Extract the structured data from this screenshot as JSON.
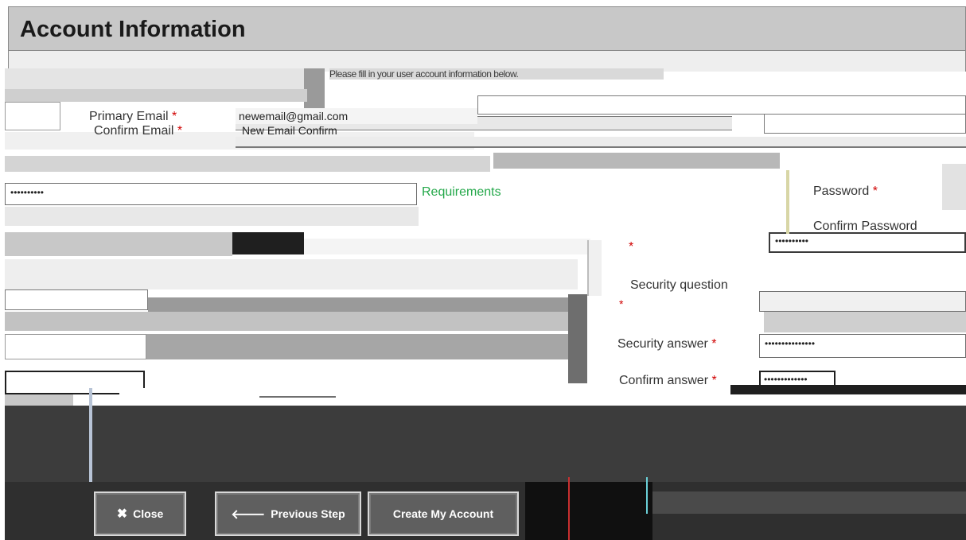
{
  "header": {
    "title": "Account Information"
  },
  "notice": {
    "text": "Please fill in your user account information below."
  },
  "fields": {
    "primary_email": {
      "label": "Primary Email",
      "value": "newemail@gmail.com"
    },
    "confirm_email": {
      "label": "Confirm Email",
      "value": "New Email Confirm"
    },
    "password": {
      "label": "Password",
      "value": "••••••••••"
    },
    "confirm_password": {
      "label": "Confirm Password",
      "value": "••••••••••"
    },
    "requirements_link": "Requirements",
    "security_question": {
      "label": "Security question",
      "value": ""
    },
    "security_answer": {
      "label": "Security answer",
      "value": "•••••••••••••••"
    },
    "confirm_answer": {
      "label": "Confirm answer",
      "value": "•••••••••••••"
    },
    "required_marker": "*"
  },
  "buttons": {
    "close": "Close",
    "previous": "Previous Step",
    "create": "Create My Account"
  },
  "colors": {
    "header_bg": "#c8c8c8",
    "requirements_link": "#24a84a",
    "required": "#d00000",
    "footer_bg": "#3c3c3c",
    "button_bg": "#5f5f5f"
  }
}
